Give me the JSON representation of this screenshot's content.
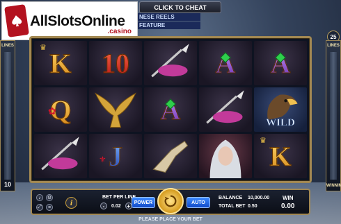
{
  "logo": {
    "brand": "AllSlotsOnline",
    "sub": ".casino"
  },
  "header": {
    "cheat_button": "CLICK TO CHEAT",
    "strip_1": "NESE REELS",
    "strip_2": "FEATURE"
  },
  "lines_left": {
    "label": "LINES",
    "top_value": "",
    "bottom_value": "10"
  },
  "lines_right": {
    "label": "LINES",
    "badge": "25",
    "bottom_label": "WINNING"
  },
  "reels": [
    [
      "K",
      "10",
      "spear",
      "A",
      "A"
    ],
    [
      "Q",
      "eagle",
      "A",
      "spear",
      "wild"
    ],
    [
      "spear",
      "J",
      "gauntlet",
      "warrior",
      "K"
    ]
  ],
  "wild_text": "WILD",
  "controls": {
    "info": "i",
    "bet_per_line_label": "BET PER LINE",
    "bet_per_line_value": "0.02",
    "power_label": "POWER",
    "auto_label": "AUTO",
    "balance_label": "BALANCE",
    "balance_value": "10,000.00",
    "total_bet_label": "TOTAL BET",
    "total_bet_value": "0.50",
    "win_label": "WIN",
    "win_value": "0.00",
    "minus": "-",
    "plus": "+"
  },
  "footer": {
    "message": "PLEASE PLACE YOUR BET"
  },
  "colors": {
    "frame": "#a28852",
    "accent_blue": "#114ac7",
    "gold": "#d59b1e"
  }
}
